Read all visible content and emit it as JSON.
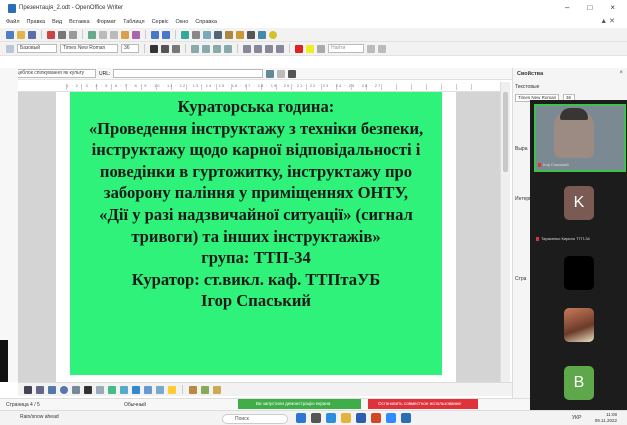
{
  "window": {
    "title": "Презентація_2.odt - OpenOffice Writer",
    "controls": [
      "–",
      "□",
      "×"
    ]
  },
  "menu": [
    "Файл",
    "Правка",
    "Вид",
    "Вставка",
    "Формат",
    "Таблиця",
    "Сервіс",
    "Окно",
    "Справка"
  ],
  "toolbar": {
    "style_value": "Базовый",
    "font_value": "Times New Roman",
    "size_value": "36",
    "find_placeholder": "Найти",
    "nav_value": "Місцеблок спілкування як культу",
    "url_label": "URL:"
  },
  "ruler": {
    "numbers": "1 · 2 · 3 · 4 · 5 · 6 · 7 · 8 · 9 · 10 · 11 · 12 · 13 · 14 · 15 · 16 · 17 · 18 · 19 · 20 · 21 · 22 · 23 · 24 · 25 · 26 · 27"
  },
  "slide": {
    "lines": [
      "Кураторська година:",
      "«Проведення інструктажу з техніки безпеки,",
      "інструктажу щодо карної відповідальності і",
      "поведінки в гуртожитку, інструктажу про",
      "заборону паління у приміщеннях ОНТУ,",
      "«Дії у разі надзвичайної ситуації» (сигнал",
      "тривоги) та інших інструктажів»",
      "група: ТТП-34",
      "Куратор: ст.викл. каф. ТТПтаУБ",
      "Ігор Спаський"
    ]
  },
  "status": {
    "page_count": "Страница 4 / 5",
    "page_style": "Обычный",
    "share_banner": "Ви запустили демонстрацію екрана",
    "stop_share": "Остановить совместное использование"
  },
  "sidebar": {
    "title": "Свойства",
    "section_text": "Текстовые",
    "font_value": "Times New Roman",
    "size_value": "36",
    "section_align": "Выра",
    "section_interval": "Интерв",
    "section_char": "Стра"
  },
  "video": {
    "tiles": [
      {
        "name": "Ігор Спаський",
        "initial": ""
      },
      {
        "name": "Тарасенко Кирило ТТП-34",
        "initial": "K",
        "color": "#7a5a52"
      },
      {
        "name": "Тетяна Лікар",
        "initial": "",
        "color": "#000000"
      },
      {
        "name": "Віка Бабкова ттп34",
        "initial": ""
      },
      {
        "name": "",
        "initial": "B",
        "color": "#5ea84b"
      }
    ]
  },
  "taskbar": {
    "weather": "Rain/snow ahead",
    "search": "Поиск",
    "lang": "УКР",
    "time": "11:08",
    "date": "09.11.2022"
  }
}
